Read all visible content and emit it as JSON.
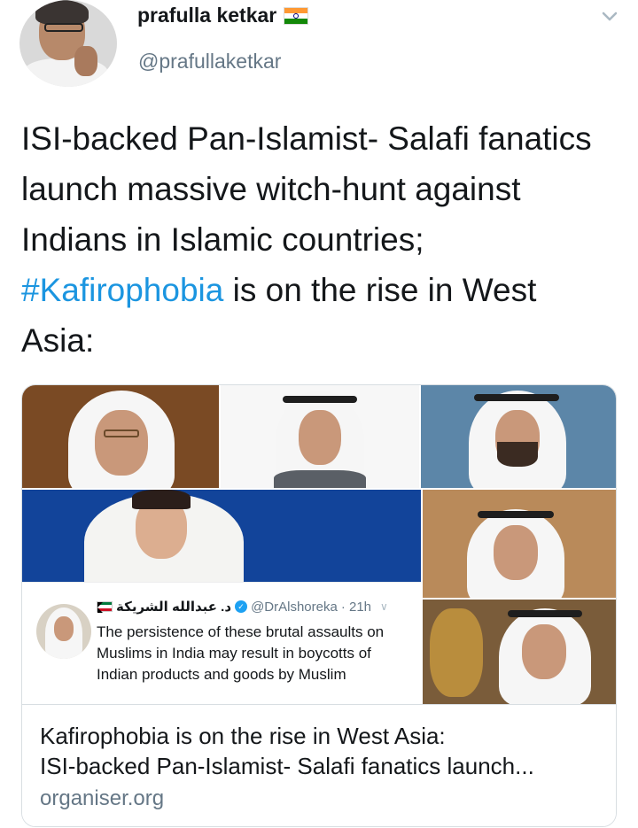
{
  "author": {
    "display_name": "prafulla ketkar",
    "handle": "@prafullaketkar",
    "flag_icon": "india-flag-icon"
  },
  "tweet": {
    "text_before_hashtag": "ISI-backed Pan-Islamist- Salafi fanatics launch massive witch-hunt against Indians in Islamic countries; ",
    "hashtag": "#Kafirophobia",
    "text_after_hashtag": " is on the rise in West Asia:"
  },
  "colors": {
    "hashtag": "#1b95e0",
    "secondary_text": "#657786",
    "verified": "#1da1f2"
  },
  "card": {
    "embedded_tweet": {
      "name_arabic": "د. عبدالله الشريكة",
      "handle": "@DrAlshoreka",
      "time": "· 21h",
      "body": "The persistence of these brutal assaults on Muslims in India may result in boycotts of Indian products and goods by Muslim"
    },
    "title_line1": "Kafirophobia is on the rise in West Asia:",
    "title_line2": "ISI-backed Pan-Islamist- Salafi fanatics launch...",
    "domain": "organiser.org"
  }
}
